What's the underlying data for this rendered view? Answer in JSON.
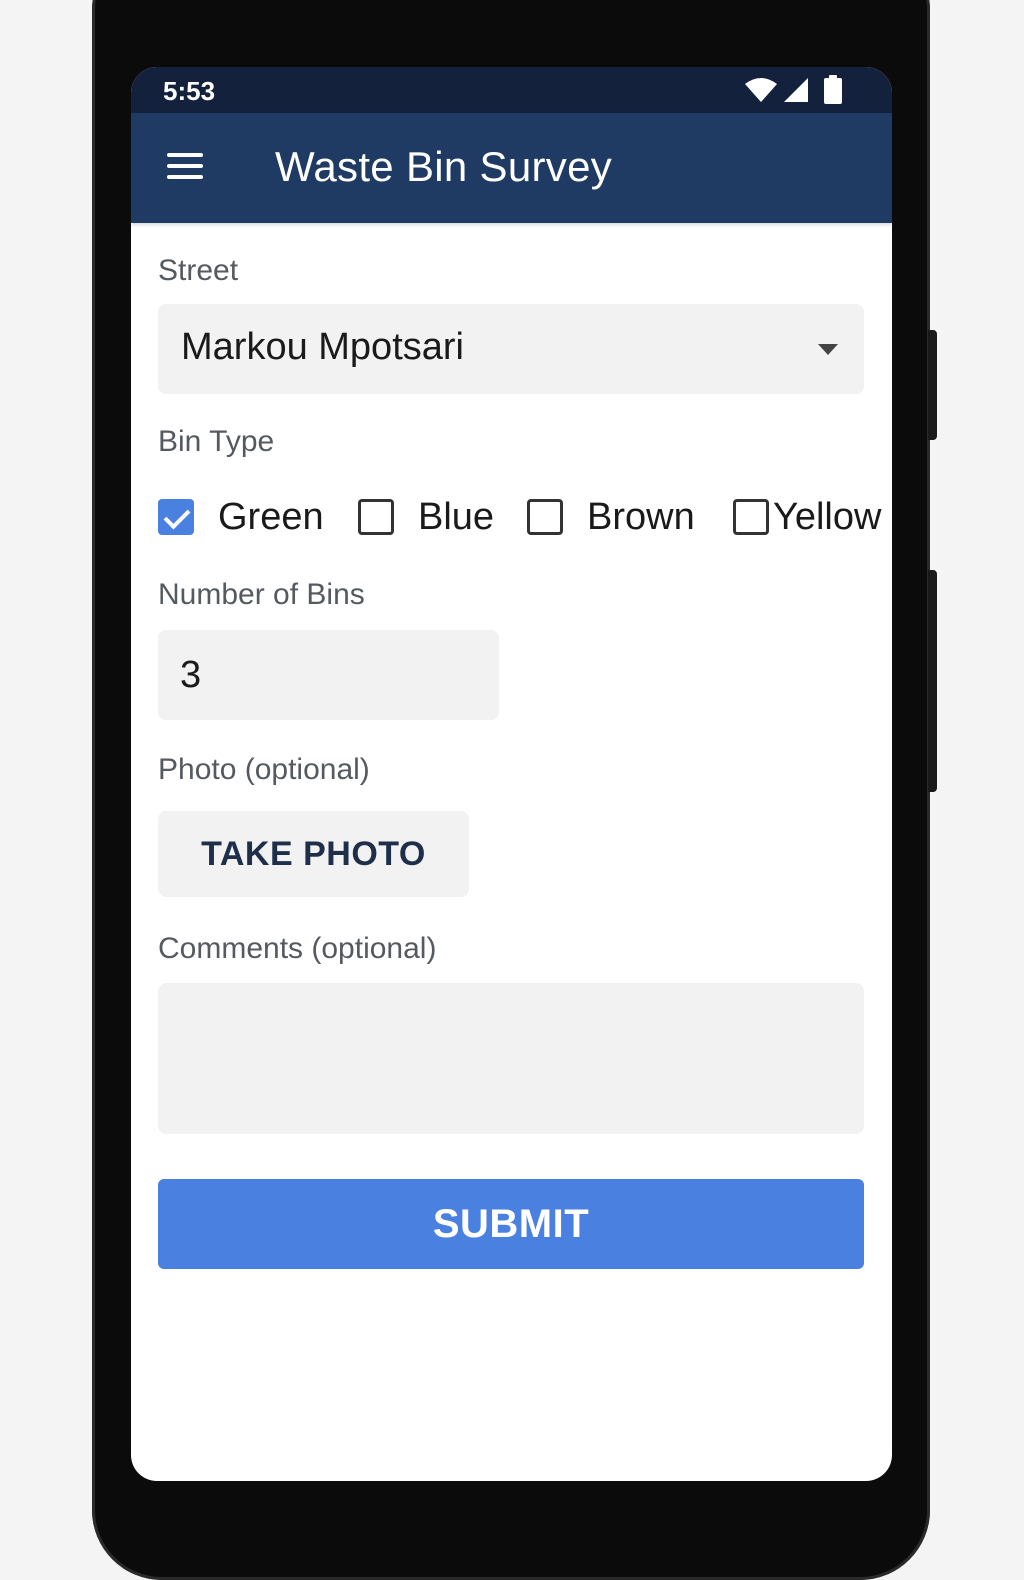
{
  "status_bar": {
    "time": "5:53",
    "icons": [
      "wifi-icon",
      "signal-icon",
      "battery-icon"
    ]
  },
  "app_bar": {
    "title": "Waste Bin Survey",
    "menu_icon": "menu-icon"
  },
  "form": {
    "street": {
      "label": "Street",
      "value": "Markou Mpotsari"
    },
    "bin_type": {
      "label": "Bin Type",
      "options": [
        {
          "label": "Green",
          "checked": true
        },
        {
          "label": "Blue",
          "checked": false
        },
        {
          "label": "Brown",
          "checked": false
        },
        {
          "label": "Yellow",
          "checked": false
        }
      ]
    },
    "number_of_bins": {
      "label": "Number of Bins",
      "value": "3"
    },
    "photo": {
      "label": "Photo (optional)",
      "button_label": "TAKE PHOTO"
    },
    "comments": {
      "label": "Comments (optional)",
      "value": ""
    },
    "submit_label": "SUBMIT"
  },
  "colors": {
    "status_bar_bg": "#14213d",
    "app_bar_bg": "#1f3a63",
    "accent": "#4a80e0",
    "field_bg": "#f2f2f2"
  }
}
